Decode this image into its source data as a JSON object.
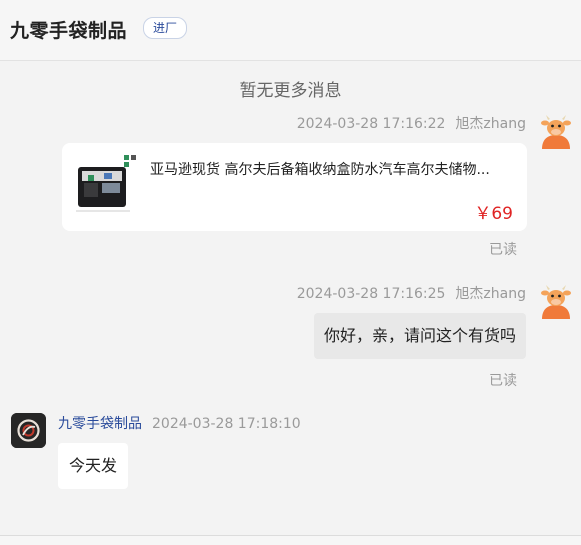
{
  "header": {
    "shop_name": "九零手袋制品",
    "badge": "进厂"
  },
  "conversation": {
    "no_more": "暂无更多消息",
    "messages": [
      {
        "time": "2024-03-28 17:16:22",
        "sender": "旭杰zhang",
        "product": {
          "title": "亚马逊现货 高尔夫后备箱收纳盒防水汽车高尔夫储物...",
          "price": "￥69"
        },
        "status": "已读"
      },
      {
        "time": "2024-03-28 17:16:25",
        "sender": "旭杰zhang",
        "text": "你好，亲，请问这个有货吗",
        "status": "已读"
      },
      {
        "time": "2024-03-28 17:18:10",
        "sender": "九零手袋制品",
        "text": "今天发"
      }
    ]
  },
  "colors": {
    "accent_blue": "#2a4b9b",
    "price_red": "#e02424",
    "avatar_orange": "#f07a3a"
  },
  "icons": {
    "user_avatar": "cartoon-cow-avatar",
    "shop_avatar": "shop-logo-avatar",
    "product_thumb": "golf-trunk-organizer-image"
  }
}
